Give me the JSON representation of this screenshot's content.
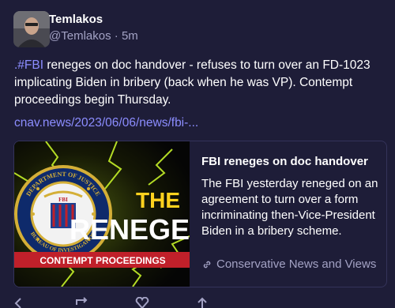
{
  "author": {
    "display_name": "Temlakos",
    "handle": "@Temlakos",
    "separator": " · ",
    "time": "5m"
  },
  "post": {
    "hashtag": ".#FBI",
    "text": " reneges on doc handover - refuses to turn over an FD-1023 implicating Biden in bribery (back when he was VP). Contempt proceedings begin Thursday.",
    "link": "cnav.news/2023/06/06/news/fbi-..."
  },
  "card": {
    "title": "FBI reneges on doc handover",
    "description": "The FBI yesterday reneged on an agreement to turn over a form incriminating then-Vice-President Biden in a bribery scheme.",
    "source": "Conservative News and Views",
    "image_text": {
      "headline_top": "THE",
      "headline_main": "RENEGE",
      "banner": "CONTEMPT PROCEEDINGS",
      "seal_top": "DEPARTMENT OF JUSTICE",
      "seal_bottom": "BUREAU OF INVESTIGATION",
      "seal_center": "FBI"
    }
  },
  "colors": {
    "background": "#1e1d38",
    "accent_link": "#8c8dff",
    "muted": "#a3a2c4",
    "banner_red": "#c0202a",
    "lightning": "#c6f22a"
  },
  "icons": [
    "link-icon",
    "reply-icon",
    "boost-icon",
    "favourite-icon",
    "bookmark-icon"
  ]
}
